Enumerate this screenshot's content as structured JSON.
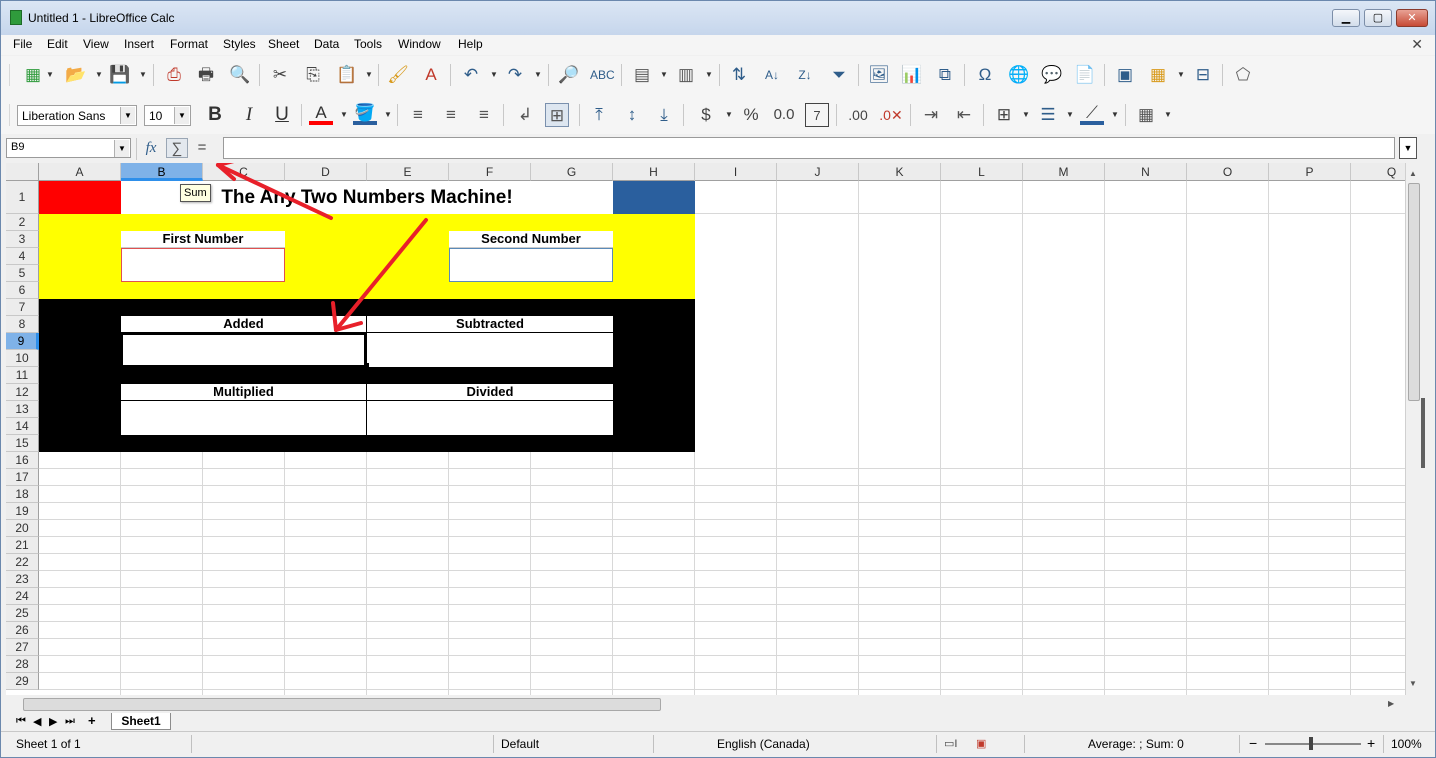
{
  "window": {
    "title": "Untitled 1 - LibreOffice Calc",
    "minimize_label": "▁",
    "maximize_label": "▢",
    "close_label": "✕"
  },
  "menubar": {
    "items": [
      "File",
      "Edit",
      "View",
      "Insert",
      "Format",
      "Styles",
      "Sheet",
      "Data",
      "Tools",
      "Window",
      "Help"
    ],
    "close_doc_label": "✕"
  },
  "formatting": {
    "font_name": "Liberation Sans",
    "font_size": "10"
  },
  "formula_bar": {
    "name_box": "B9",
    "fx_label": "fx",
    "sum_label": "∑",
    "equals_label": "=",
    "formula_value": ""
  },
  "tooltip": "Sum",
  "columns": [
    "A",
    "B",
    "C",
    "D",
    "E",
    "F",
    "G",
    "H",
    "I",
    "J",
    "K",
    "L",
    "M",
    "N",
    "O",
    "P",
    "Q"
  ],
  "selected_column": "B",
  "rows": [
    "1",
    "2",
    "3",
    "4",
    "5",
    "6",
    "7",
    "8",
    "9",
    "10",
    "11",
    "12",
    "13",
    "14",
    "15",
    "16",
    "17",
    "18",
    "19",
    "20",
    "21",
    "22",
    "23",
    "24",
    "25",
    "26",
    "27",
    "28",
    "29"
  ],
  "selected_row": "9",
  "sheet_content": {
    "title": "The Any Two Numbers Machine!",
    "first_number_label": "First Number",
    "second_number_label": "Second Number",
    "added_label": "Added",
    "subtracted_label": "Subtracted",
    "multiplied_label": "Multiplied",
    "divided_label": "Divided"
  },
  "colors": {
    "red": "#ff0000",
    "yellow": "#ffff00",
    "black": "#000000",
    "blue": "#2a5f9e",
    "annotation_arrow": "#e8202a"
  },
  "sheet_tabs": {
    "tabs": [
      "Sheet1"
    ],
    "add_label": "+"
  },
  "status_bar": {
    "sheet_info": "Sheet 1 of 1",
    "page_style": "Default",
    "language": "English (Canada)",
    "summary": "Average: ; Sum: 0",
    "zoom_minus": "−",
    "zoom_plus": "+",
    "zoom": "100%"
  }
}
